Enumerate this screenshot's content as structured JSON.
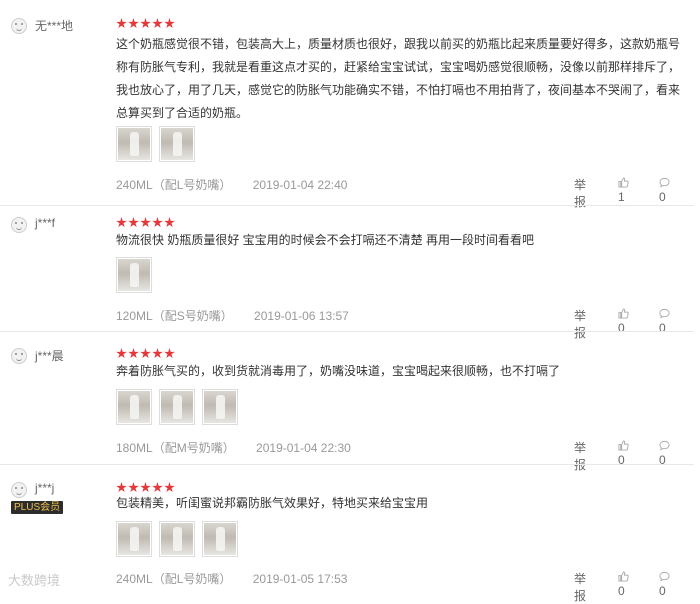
{
  "reviews": [
    {
      "username": "无***地",
      "plus_badge": "",
      "stars": 5,
      "text": "这个奶瓶感觉很不错，包装高大上，质量材质也很好，跟我以前买的奶瓶比起来质量要好得多，这款奶瓶号称有防胀气专利，我就是看重这点才买的，赶紧给宝宝试试，宝宝喝奶感觉很顺畅，没像以前那样排斥了，我也放心了，用了几天，感觉它的防胀气功能确实不错，不怕打嗝也不用拍背了，夜间基本不哭闹了，看来总算买到了合适的奶瓶。",
      "thumb_count": 2,
      "spec": "240ML（配L号奶嘴）",
      "date": "2019-01-04 22:40",
      "report": "举报",
      "likes": "1",
      "replies": "0"
    },
    {
      "username": "j***f",
      "plus_badge": "",
      "stars": 5,
      "text": "物流很快 奶瓶质量很好 宝宝用的时候会不会打嗝还不清楚 再用一段时间看看吧",
      "thumb_count": 1,
      "spec": "120ML（配S号奶嘴）",
      "date": "2019-01-06 13:57",
      "report": "举报",
      "likes": "0",
      "replies": "0"
    },
    {
      "username": "j***晨",
      "plus_badge": "",
      "stars": 5,
      "text": "奔着防胀气买的，收到货就消毒用了，奶嘴没味道，宝宝喝起来很顺畅，也不打嗝了",
      "thumb_count": 3,
      "spec": "180ML（配M号奶嘴）",
      "date": "2019-01-04 22:30",
      "report": "举报",
      "likes": "0",
      "replies": "0"
    },
    {
      "username": "j***j",
      "plus_badge": "PLUS会员",
      "stars": 5,
      "text": "包装精美，听闺蜜说邦霸防胀气效果好，特地买来给宝宝用",
      "thumb_count": 3,
      "spec": "240ML（配L号奶嘴）",
      "date": "2019-01-05 17:53",
      "report": "举报",
      "likes": "0",
      "replies": "0"
    }
  ],
  "watermark": "大数跨境",
  "colors": {
    "star": "#e4393c",
    "meta": "#999999",
    "separator": "#e8e8e8"
  }
}
